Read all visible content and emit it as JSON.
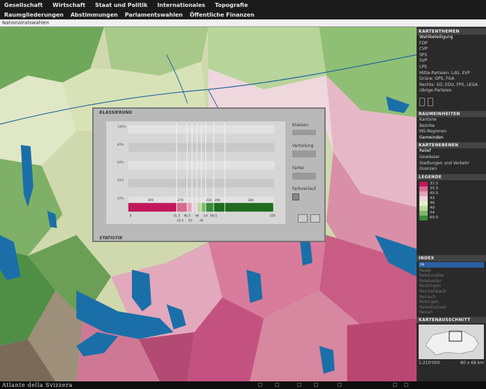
{
  "menu": {
    "items": [
      "Gesellschaft",
      "Wirtschaft",
      "Staat und Politik",
      "Internationales",
      "Topografie"
    ],
    "sub": [
      "Raumgliederungen",
      "Abstimmungen",
      "Parlamentswahlen",
      "Öffentliche Finanzen"
    ],
    "breadcrumb": "Nationalratswahlen"
  },
  "panel": {
    "kartenthemen_title": "KARTENTHEMEN",
    "kartenthemen": [
      "Wahlbeteiligung",
      "FDP",
      "CVP",
      "SPS",
      "SVP",
      "LPS",
      "Mitte-Parteien: LdU, EVP",
      "Grüne: GPS, FGA",
      "Rechte: SD, EDU, FPS, LEGA",
      "Übrige Parteien"
    ],
    "raumeinheiten_title": "RAUMEINHEITEN",
    "raumeinheiten": [
      "Kantone",
      "Bezirke",
      "MS-Regionen",
      "Gemeinden"
    ],
    "kartenebenen_title": "KARTENEBENEN",
    "kartenebenen": [
      "Relief",
      "Gewässer",
      "Siedlungen und Verkehr",
      "Grenzen"
    ],
    "legende_title": "LEGENDE",
    "legend": [
      "31.5",
      "35.5",
      "40.5",
      "43",
      "46",
      "49",
      "54",
      "60.5"
    ],
    "legend_colors": [
      "#c2185b",
      "#d46a8f",
      "#e3a4b8",
      "#efd2dc",
      "#e6f0c8",
      "#b9d99a",
      "#7cb86a",
      "#3a8a3a"
    ],
    "index_title": "INDEX",
    "index_input": "re",
    "index_items": [
      "Realp",
      "Rebeuvelier",
      "Rebévelier",
      "Reckingen",
      "Reichenbach",
      "Reinach",
      "Rekingen",
      "Remetschwil",
      "Renan"
    ],
    "ausschnitt_title": "KARTENAUSSCHNITT",
    "scale": "1:210'000",
    "size": "80 x 68 km"
  },
  "dialog": {
    "title": "KLASSIERUNG",
    "stat": "STATISTIK",
    "klassen": "Klassen",
    "verteilung": "Verteilung",
    "farbe": "Farbe",
    "farbverlauf": "Farbverlauf"
  },
  "chart_data": {
    "type": "bar",
    "ylabels": [
      "100%",
      "80%",
      "60%",
      "40%",
      "20%"
    ],
    "bar_counts": [
      "309",
      "279",
      "318",
      "284",
      "284"
    ],
    "breaks": [
      "31.5",
      "35.5",
      "40.5",
      "43",
      "46",
      "49",
      "54",
      "60.5"
    ],
    "x_labels": [
      "0",
      "100"
    ],
    "class_colors": [
      "#c2185b",
      "#d46a8f",
      "#e3a4b8",
      "#efd2dc",
      "#e6f0c8",
      "#b9d99a",
      "#7cb86a",
      "#3a8a3a",
      "#1f6b1f"
    ]
  },
  "brand": "Atlante della Svizzera"
}
